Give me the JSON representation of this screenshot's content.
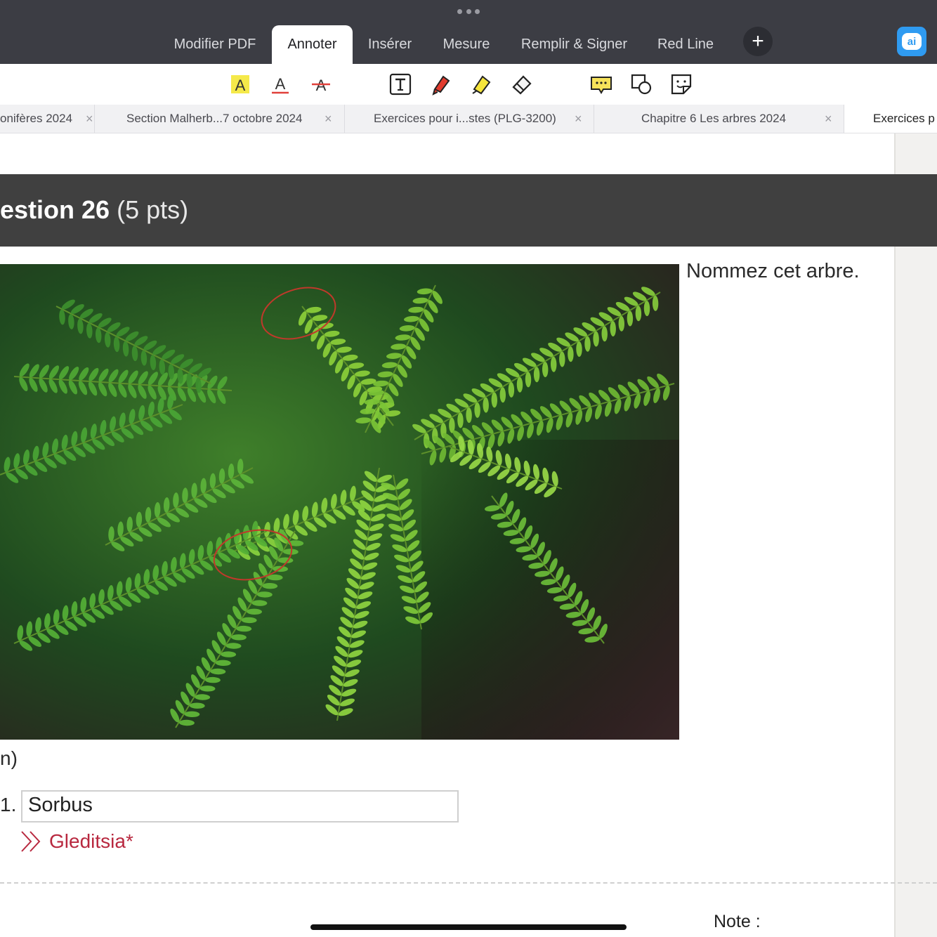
{
  "toolbar": {
    "tabs": [
      "Modifier PDF",
      "Annoter",
      "Insérer",
      "Mesure",
      "Remplir & Signer",
      "Red Line"
    ],
    "active_tab": "Annoter",
    "plus": "+",
    "ai": "ai"
  },
  "annotate_tools": [
    "text-highlight-icon",
    "text-underline-icon",
    "text-strikethrough-icon",
    "text-box-icon",
    "pen-icon",
    "highlighter-icon",
    "eraser-icon",
    "comment-icon",
    "shapes-icon",
    "sticker-icon"
  ],
  "document_tabs": [
    {
      "label": "onifères 2024"
    },
    {
      "label": "Section Malherb...7 octobre 2024"
    },
    {
      "label": "Exercices pour i...stes (PLG-3200)"
    },
    {
      "label": "Chapitre 6 Les arbres  2024"
    },
    {
      "label": "Exercices p"
    }
  ],
  "close_glyph": "×",
  "question": {
    "title": "estion 26",
    "points": "(5 pts)",
    "prompt": "Nommez cet arbre.",
    "fragment_paren": "n)",
    "fragment_num": "1.",
    "answer": "Sorbus",
    "correct_answer": "Gleditsia*",
    "note_label": "Note :"
  },
  "colors": {
    "toolbar_bg": "#3c3d44",
    "question_bar": "#404040",
    "correct_answer": "#b8283f",
    "annotation_circle": "#c0392b",
    "ai_button": "#2f9bf1"
  }
}
